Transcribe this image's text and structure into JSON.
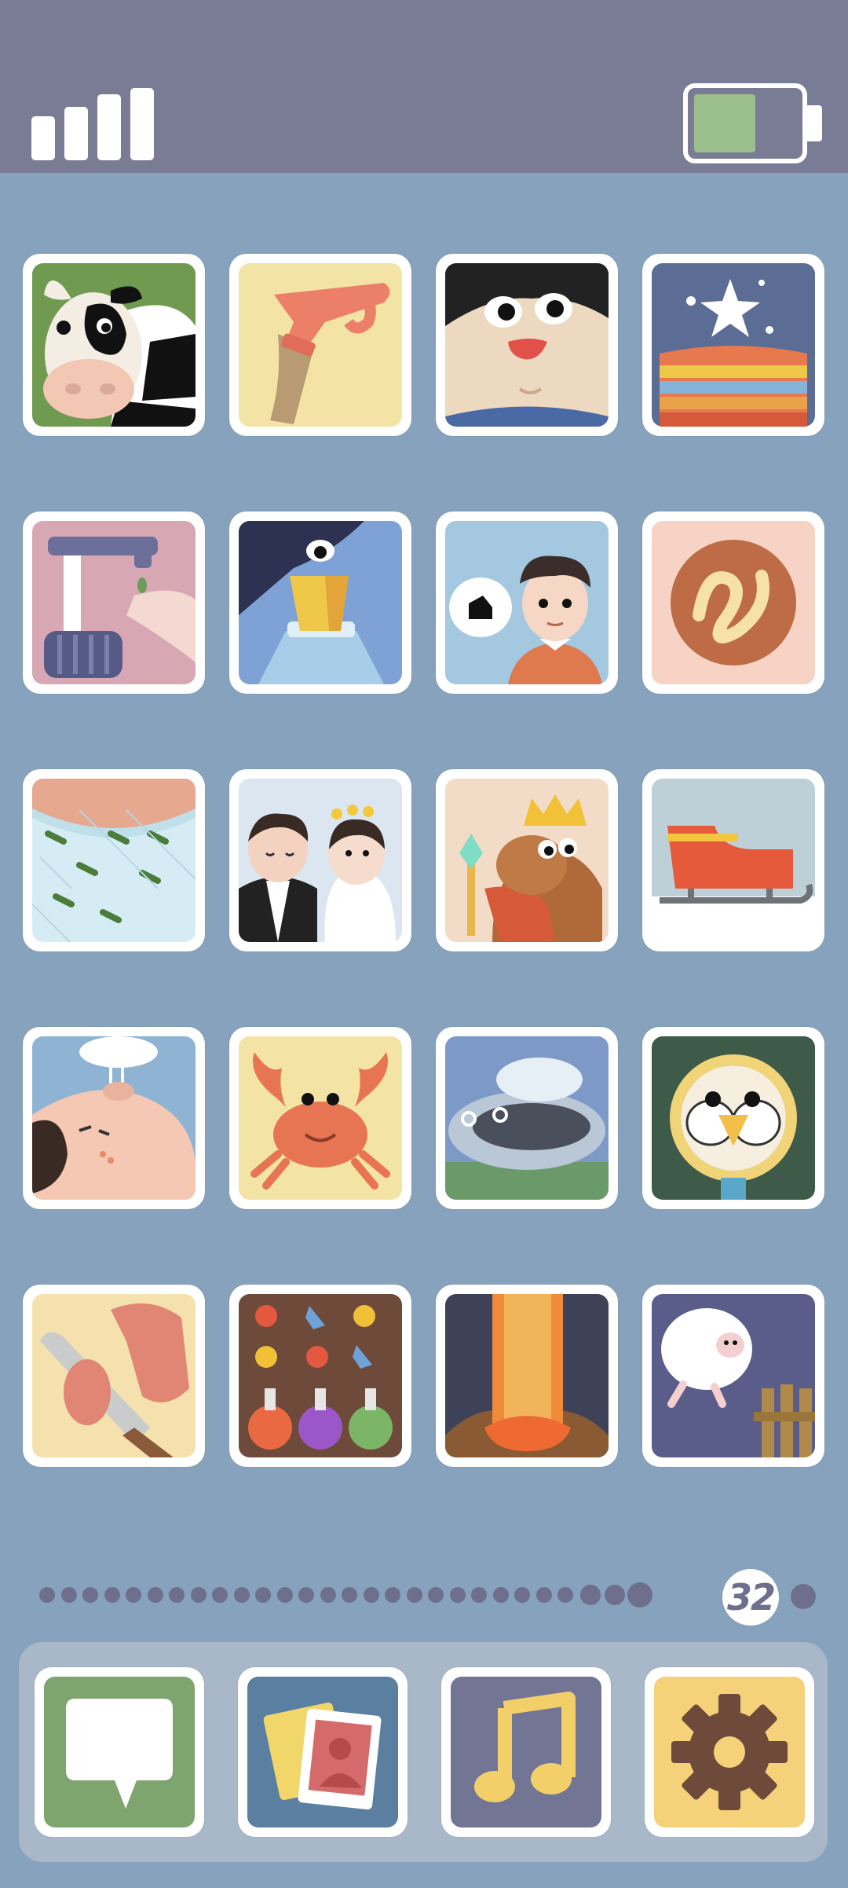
{
  "status_bar": {
    "signal_icon": "signal-bars-icon",
    "battery_icon": "battery-icon",
    "battery_level": 0.6,
    "colors": {
      "bar_bg": "#7a7b95",
      "battery_fill": "#9bbf8c"
    }
  },
  "grid": {
    "tiles": [
      {
        "icon": "cow-icon"
      },
      {
        "icon": "toy-gun-icon"
      },
      {
        "icon": "face-icon"
      },
      {
        "icon": "birthday-cake-icon"
      },
      {
        "icon": "soap-dispenser-icon"
      },
      {
        "icon": "juice-bottle-icon"
      },
      {
        "icon": "boy-speech-icon"
      },
      {
        "icon": "cookie-icon"
      },
      {
        "icon": "sweater-icon"
      },
      {
        "icon": "wedding-couple-icon"
      },
      {
        "icon": "king-dog-icon"
      },
      {
        "icon": "sled-icon"
      },
      {
        "icon": "sneezing-nose-icon"
      },
      {
        "icon": "crab-icon"
      },
      {
        "icon": "hot-pan-icon"
      },
      {
        "icon": "owl-magnifier-icon"
      },
      {
        "icon": "knife-hand-icon"
      },
      {
        "icon": "flower-potions-icon"
      },
      {
        "icon": "waterfall-icon"
      },
      {
        "icon": "sheep-fence-icon"
      }
    ]
  },
  "pagination": {
    "level_label": "32",
    "small_dot_count": 28,
    "colors": {
      "dot": "#6d6f8d"
    }
  },
  "dock": {
    "apps": [
      {
        "icon": "chat-bubble-icon"
      },
      {
        "icon": "photos-icon"
      },
      {
        "icon": "music-note-icon"
      },
      {
        "icon": "settings-gear-icon"
      }
    ]
  }
}
